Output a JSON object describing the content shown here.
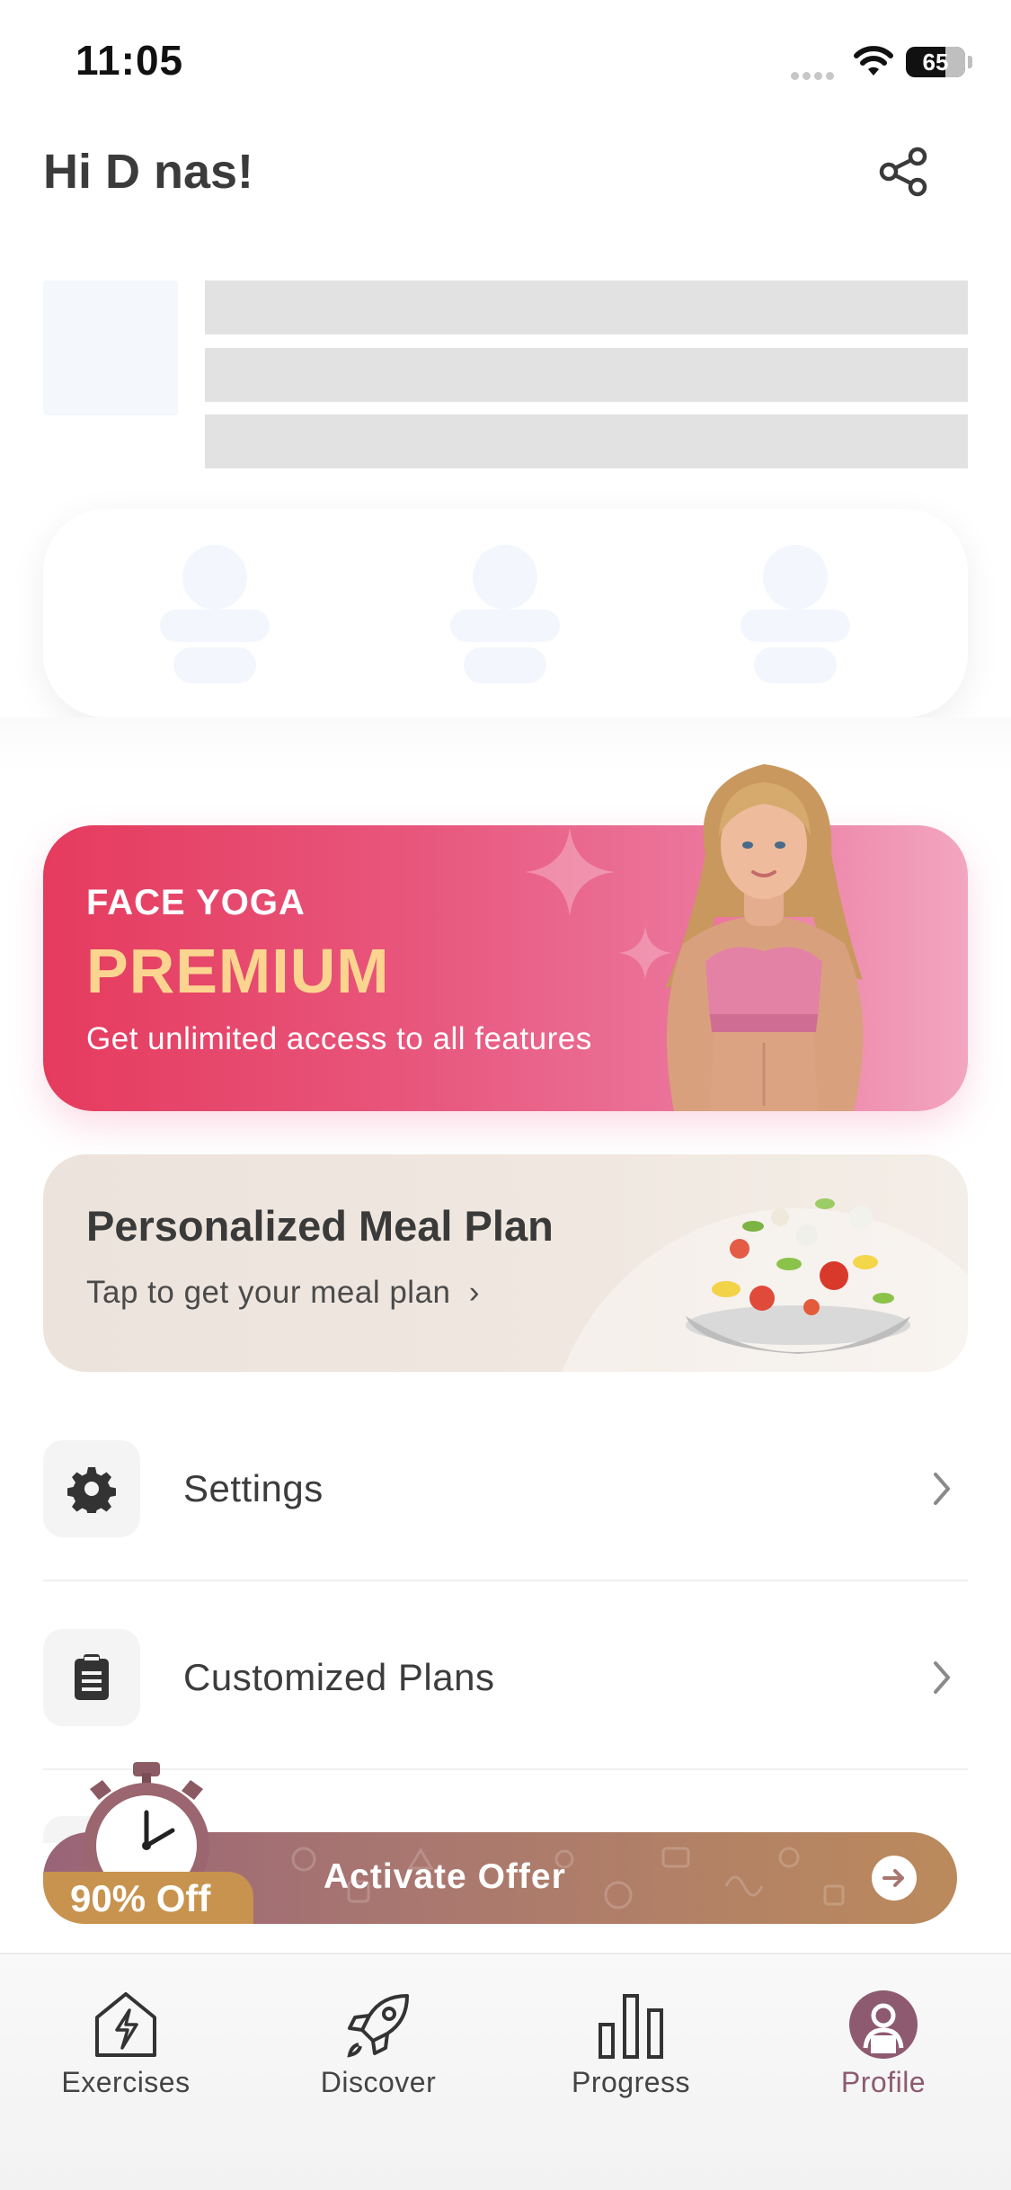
{
  "status_bar": {
    "time": "11:05",
    "battery": "65"
  },
  "header": {
    "greeting": "Hi D nas!"
  },
  "premium_banner": {
    "kicker": "FACE YOGA",
    "title": "PREMIUM",
    "subtitle": "Get unlimited access to all features"
  },
  "meal_plan": {
    "title": "Personalized Meal Plan",
    "subtitle": "Tap to get your meal plan",
    "chevron": "›"
  },
  "menu": {
    "items": [
      {
        "label": "Settings",
        "icon": "gear-icon"
      },
      {
        "label": "Customized Plans",
        "icon": "clipboard-icon"
      }
    ]
  },
  "offer": {
    "badge": "90% Off",
    "label": "Activate Offer"
  },
  "tab_bar": {
    "tabs": [
      {
        "label": "Exercises",
        "icon": "exercises-icon"
      },
      {
        "label": "Discover",
        "icon": "rocket-icon"
      },
      {
        "label": "Progress",
        "icon": "bar-chart-icon"
      },
      {
        "label": "Profile",
        "icon": "profile-icon",
        "active": true
      }
    ]
  },
  "colors": {
    "premium_gradient_start": "#e53b5e",
    "premium_title": "#fbd58f",
    "active_tab": "#8d5a70",
    "offer_badge": "#c8934e"
  }
}
